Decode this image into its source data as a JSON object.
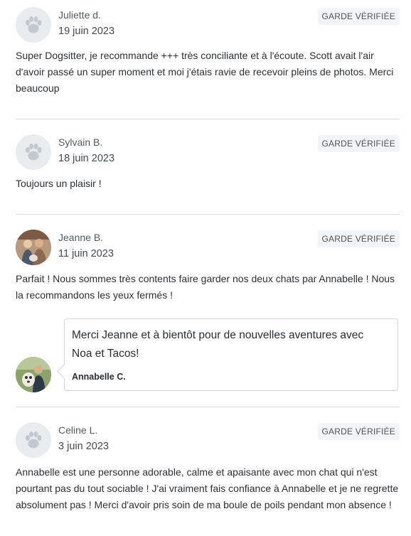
{
  "colors": {
    "badge_bg": "#f3f4f6",
    "divider": "#d9dcdf",
    "placeholder_avatar": "#e9ecef",
    "paw": "#c3c9cf"
  },
  "reviews": [
    {
      "author": "Juliette d.",
      "date": "19 juin 2023",
      "badge": "GARDE VÉRIFIÉE",
      "avatar_icon": "paw-icon",
      "text": "Super Dogsitter, je recommande +++ très conciliante et à l'écoute. Scott avait l'air d'avoir passé un super moment et moi j'étais ravie de recevoir pleins de photos. Merci beaucoup"
    },
    {
      "author": "Sylvain B.",
      "date": "18 juin 2023",
      "badge": "GARDE VÉRIFIÉE",
      "avatar_icon": "paw-icon",
      "text": "Toujours un plaisir !"
    },
    {
      "author": "Jeanne B.",
      "date": "11 juin 2023",
      "badge": "GARDE VÉRIFIÉE",
      "avatar_icon": "user-photo",
      "text": "Parfait ! Nous sommes très contents faire garder nos deux chats par Annabelle ! Nous la recommandons les yeux fermés !",
      "reply": {
        "text": "Merci Jeanne et à bientôt pour de nouvelles aventures avec Noa et Tacos!",
        "author": "Annabelle C."
      }
    },
    {
      "author": "Celine L.",
      "date": "3 juin 2023",
      "badge": "GARDE VÉRIFIÉE",
      "avatar_icon": "paw-icon",
      "text": "Annabelle est une personne adorable, calme et apaisante avec mon chat qui n'est pourtant pas du tout sociable ! J'ai vraiment fais confiance à Annabelle et je ne regrette absolument pas ! Merci d'avoir pris soin de ma boule de poils pendant mon absence !"
    }
  ]
}
